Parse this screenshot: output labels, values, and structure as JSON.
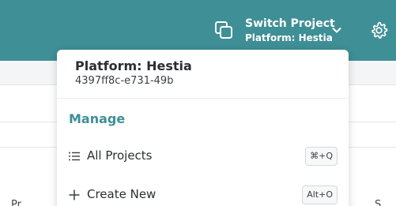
{
  "header": {
    "switch_project_label": "Switch Project",
    "current_project": "Platform: Hestia",
    "icons": {
      "switch": "copy-stack-icon",
      "chevron": "chevron-down-icon",
      "settings": "gear-icon"
    },
    "background_color": "#3f8f96"
  },
  "dropdown": {
    "project_name": "Platform: Hestia",
    "project_id": "4397ff8c-e731-49b",
    "section_title": "Manage",
    "items": [
      {
        "label": "All Projects",
        "icon": "list-icon",
        "shortcut": "⌘+Q"
      },
      {
        "label": "Create New",
        "icon": "plus-icon",
        "shortcut": "Alt+O"
      }
    ]
  },
  "background": {
    "fragment_left": "Pr",
    "fragment_right": "S"
  },
  "colors": {
    "accent": "#3f8f96",
    "text": "#2b2f33"
  }
}
